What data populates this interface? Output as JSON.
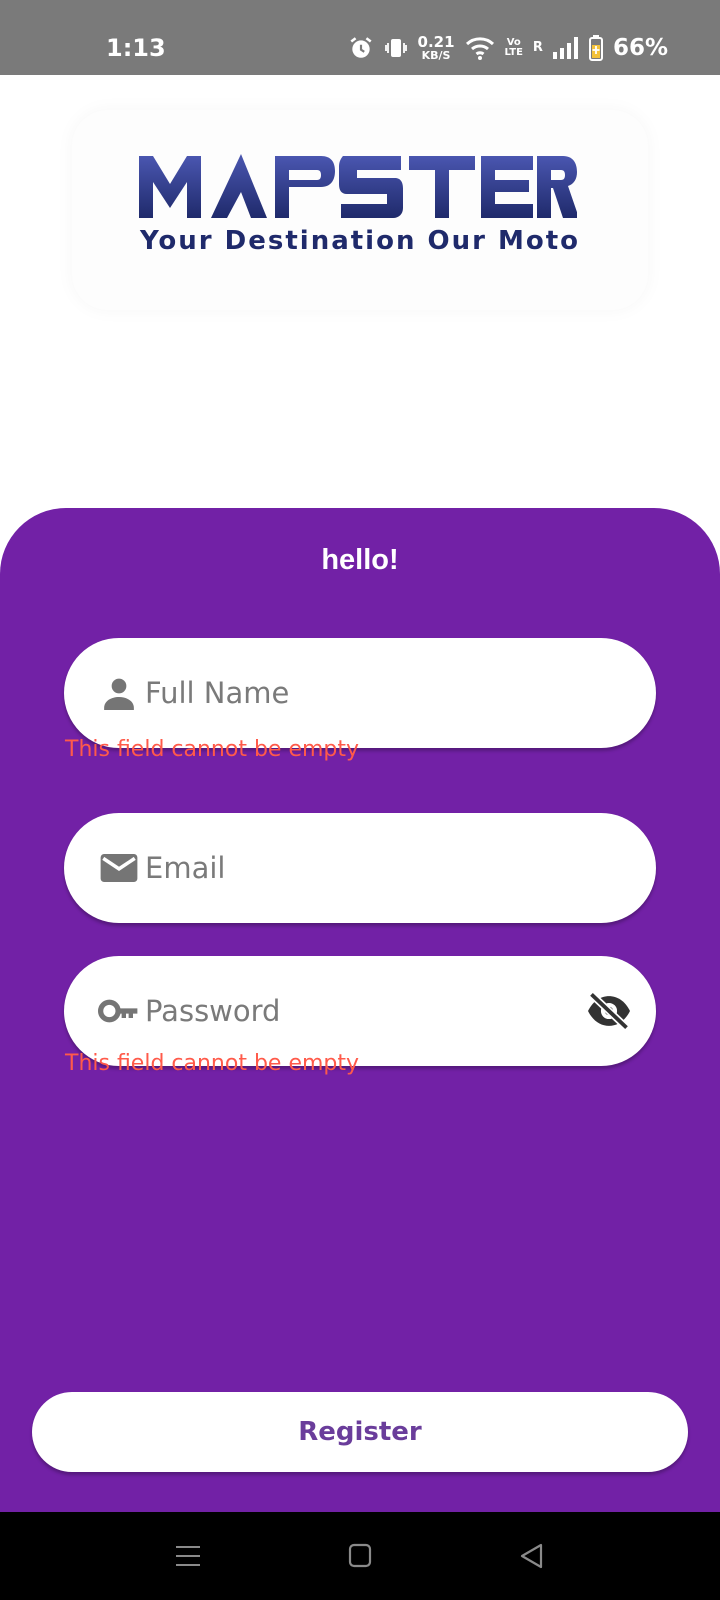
{
  "status_bar": {
    "time": "1:13",
    "net_speed_value": "0.21",
    "net_speed_unit": "KB/S",
    "volte_top": "Vo",
    "volte_bottom": "LTE",
    "roaming": "R",
    "battery": "66%"
  },
  "logo": {
    "wordmark": "MAPSTER",
    "tagline": "Your Destination Our Moto",
    "colors": {
      "wordmark": "#2b3a8c",
      "tagline": "#1f2a6b"
    }
  },
  "form": {
    "greeting": "hello!",
    "fields": {
      "full_name": {
        "placeholder": "Full Name",
        "value": "",
        "icon": "person-icon",
        "error": "This field cannot be empty"
      },
      "email": {
        "placeholder": "Email",
        "value": "",
        "icon": "mail-icon"
      },
      "password": {
        "placeholder": "Password",
        "value": "",
        "icon": "key-icon",
        "toggle_icon": "visibility-off-icon",
        "error": "This field cannot be empty"
      }
    },
    "register_label": "Register"
  },
  "colors": {
    "panel": "#7221a6",
    "error": "#ff5a4a",
    "button_text": "#6a3d9b"
  },
  "nav_bar": {
    "icons": [
      "menu-icon",
      "home-square-icon",
      "back-triangle-icon"
    ]
  }
}
